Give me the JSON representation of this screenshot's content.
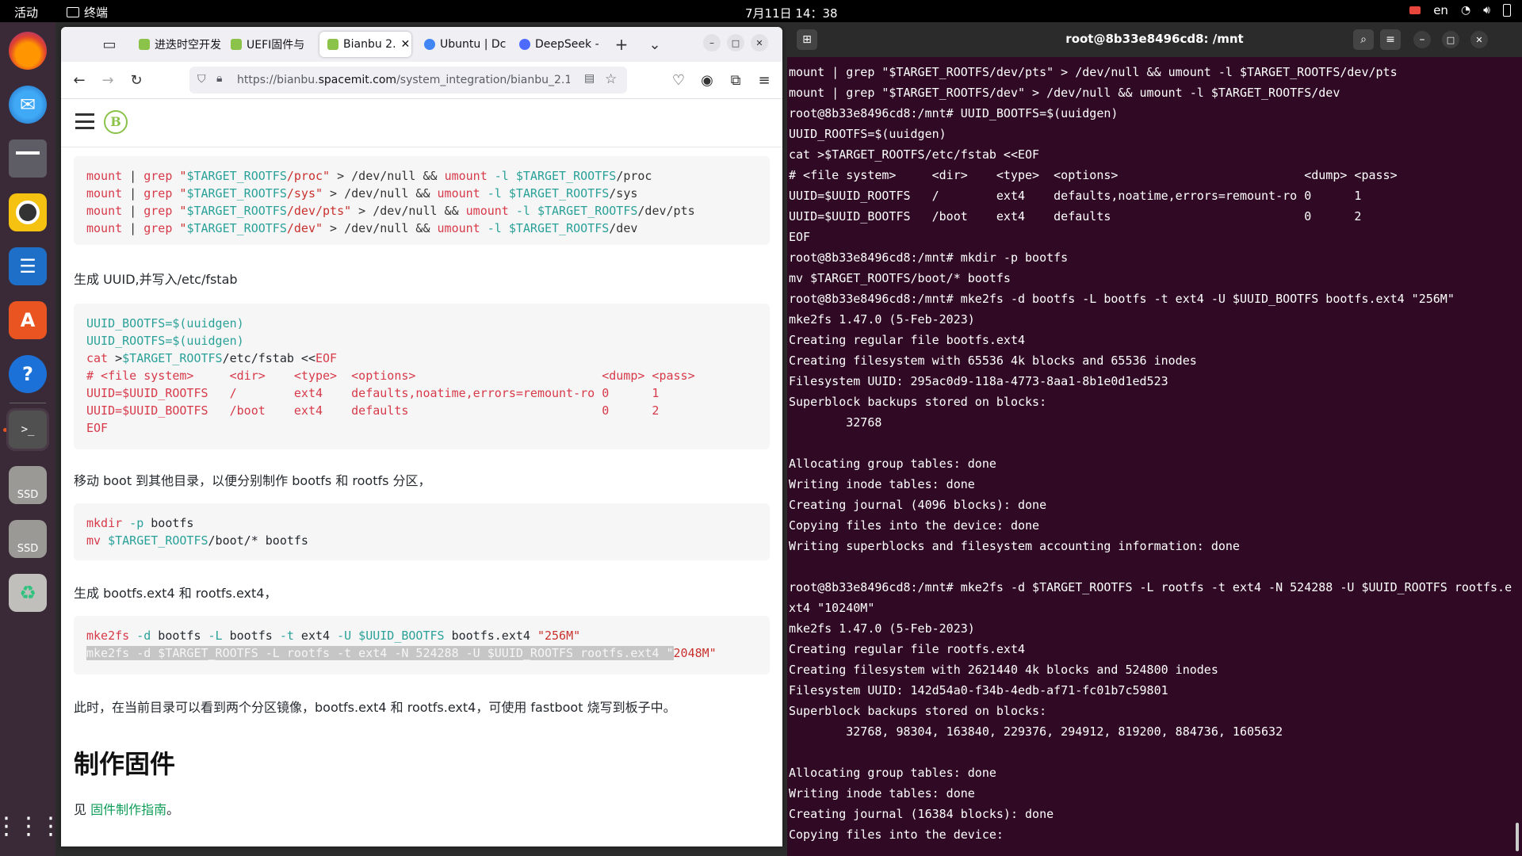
{
  "topbar": {
    "activities": "活动",
    "app_name": "终端",
    "clock": "7月11日 14：38",
    "lang": "en"
  },
  "dock": {
    "items": [
      "firefox-icon",
      "thunderbird-icon",
      "files-icon",
      "rhythmbox-icon",
      "writer-icon",
      "app-center-icon",
      "help-icon",
      "terminal-icon",
      "ssd-icon",
      "ssd-icon",
      "trash-icon",
      "app-grid-icon"
    ],
    "ssd_label": "SSD"
  },
  "browser": {
    "tabs": [
      {
        "label": "进迭时空开发"
      },
      {
        "label": "UEFI固件与"
      },
      {
        "label": "Bianbu 2."
      },
      {
        "label": "Ubuntu | Dc"
      },
      {
        "label": "DeepSeek -"
      }
    ],
    "url_prefix": "https://bianbu.",
    "url_domain": "spacemit.com",
    "url_suffix": "/system_integration/bianbu_2.1_"
  },
  "page": {
    "code1": [
      [
        "mount",
        " | ",
        "grep",
        " \"",
        "$TARGET_ROOTFS",
        "/proc\"",
        " > /dev/null && ",
        "umount",
        " -l ",
        "$TARGET_ROOTFS",
        "/proc"
      ],
      [
        "mount",
        " | ",
        "grep",
        " \"",
        "$TARGET_ROOTFS",
        "/sys\"",
        " > /dev/null && ",
        "umount",
        " -l ",
        "$TARGET_ROOTFS",
        "/sys"
      ],
      [
        "mount",
        " | ",
        "grep",
        " \"",
        "$TARGET_ROOTFS",
        "/dev/pts\"",
        " > /dev/null && ",
        "umount",
        " -l ",
        "$TARGET_ROOTFS",
        "/dev/pts"
      ],
      [
        "mount",
        " | ",
        "grep",
        " \"",
        "$TARGET_ROOTFS",
        "/dev\"",
        " > /dev/null && ",
        "umount",
        " -l ",
        "$TARGET_ROOTFS",
        "/dev"
      ]
    ],
    "para1": "生成 UUID,并写入/etc/fstab",
    "code2": {
      "l1a": "UUID_BOOTFS",
      "l1b": "=$(uuidgen)",
      "l2a": "UUID_ROOTFS",
      "l2b": "=$(uuidgen)",
      "l3a": "cat",
      "l3b": " >",
      "l3c": "$TARGET_ROOTFS",
      "l3d": "/etc/fstab <<",
      "l3e": "EOF",
      "l4": "# <file system>     <dir>    <type>  <options>                          <dump> <pass>",
      "l5": "UUID=$UUID_ROOTFS   /        ext4    defaults,noatime,errors=remount-ro 0      1",
      "l6": "UUID=$UUID_BOOTFS   /boot    ext4    defaults                           0      2",
      "l7": "EOF"
    },
    "para2": "移动 boot 到其他目录，以便分别制作 bootfs 和 rootfs 分区，",
    "code3": {
      "l1a": "mkdir",
      "l1b": " -p",
      "l1c": " bootfs",
      "l2a": "mv",
      "l2b": " $TARGET_ROOTFS",
      "l2c": "/boot/* bootfs"
    },
    "para3": "生成 bootfs.ext4 和 rootfs.ext4，",
    "code4": {
      "l1a": "mke2fs",
      "l1b": " -d",
      "l1c": " bootfs ",
      "l1d": "-L",
      "l1e": " bootfs ",
      "l1f": "-t",
      "l1g": " ext4 ",
      "l1h": "-U",
      "l1i": " $UUID_BOOTFS",
      "l1j": " bootfs.ext4 ",
      "l1k": "\"256M\"",
      "l2sel": "mke2fs -d $TARGET_ROOTFS -L rootfs -t ext4 -N 524288 -U $UUID_ROOTFS rootfs.ext4 \"",
      "l2rest": "2048M\""
    },
    "para4": "此时，在当前目录可以看到两个分区镜像，bootfs.ext4 和 rootfs.ext4，可使用 fastboot 烧写到板子中。",
    "heading": "制作固件",
    "para5_prefix": "见 ",
    "para5_link": "固件制作指南",
    "para5_suffix": "。"
  },
  "terminal": {
    "title": "root@8b33e8496cd8: /mnt",
    "lines": [
      "mount | grep \"$TARGET_ROOTFS/dev/pts\" > /dev/null && umount -l $TARGET_ROOTFS/dev/pts",
      "mount | grep \"$TARGET_ROOTFS/dev\" > /dev/null && umount -l $TARGET_ROOTFS/dev",
      "root@8b33e8496cd8:/mnt# UUID_BOOTFS=$(uuidgen)",
      "UUID_ROOTFS=$(uuidgen)",
      "cat >$TARGET_ROOTFS/etc/fstab <<EOF",
      "# <file system>     <dir>    <type>  <options>                          <dump> <pass>",
      "UUID=$UUID_ROOTFS   /        ext4    defaults,noatime,errors=remount-ro 0      1",
      "UUID=$UUID_BOOTFS   /boot    ext4    defaults                           0      2",
      "EOF",
      "root@8b33e8496cd8:/mnt# mkdir -p bootfs",
      "mv $TARGET_ROOTFS/boot/* bootfs",
      "root@8b33e8496cd8:/mnt# mke2fs -d bootfs -L bootfs -t ext4 -U $UUID_BOOTFS bootfs.ext4 \"256M\"",
      "mke2fs 1.47.0 (5-Feb-2023)",
      "Creating regular file bootfs.ext4",
      "Creating filesystem with 65536 4k blocks and 65536 inodes",
      "Filesystem UUID: 295ac0d9-118a-4773-8aa1-8b1e0d1ed523",
      "Superblock backups stored on blocks:",
      "        32768",
      "",
      "Allocating group tables: done",
      "Writing inode tables: done",
      "Creating journal (4096 blocks): done",
      "Copying files into the device: done",
      "Writing superblocks and filesystem accounting information: done",
      "",
      "root@8b33e8496cd8:/mnt# mke2fs -d $TARGET_ROOTFS -L rootfs -t ext4 -N 524288 -U $UUID_ROOTFS rootfs.e",
      "xt4 \"10240M\"",
      "mke2fs 1.47.0 (5-Feb-2023)",
      "Creating regular file rootfs.ext4",
      "Creating filesystem with 2621440 4k blocks and 524800 inodes",
      "Filesystem UUID: 142d54a0-f34b-4edb-af71-fc01b7c59801",
      "Superblock backups stored on blocks:",
      "        32768, 98304, 163840, 229376, 294912, 819200, 884736, 1605632",
      "",
      "Allocating group tables: done",
      "Writing inode tables: done",
      "Creating journal (16384 blocks): done",
      "Copying files into the device:"
    ]
  },
  "colors": {
    "ubuntu_orange": "#e95420",
    "terminal_bg": "#300a24",
    "link": "#0f9d58"
  }
}
